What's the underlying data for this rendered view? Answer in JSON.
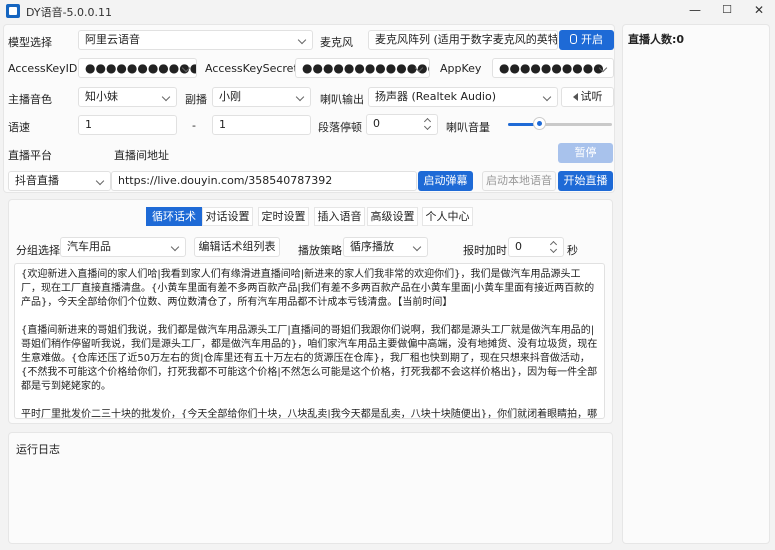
{
  "window": {
    "title": "DY语音-5.0.0.11",
    "minimize": "—",
    "maximize": "☐",
    "close": "✕"
  },
  "row1": {
    "model_label": "模型选择",
    "model_value": "阿里云语音",
    "mic_label": "麦克风",
    "mic_value": "麦克风阵列 (适用于数字麦克风的英特",
    "start_label": "开启"
  },
  "row2": {
    "akid_label": "AccessKeyID",
    "akid_value": "●●●●●●●●●●●●●",
    "aks_label": "AccessKeySecret",
    "aks_value": "●●●●●●●●●●●●●●●",
    "appkey_label": "AppKey",
    "appkey_value": "●●●●●●●●●●"
  },
  "row3": {
    "voice_label": "主播音色",
    "voice_value": "知小妹",
    "sub_label": "副播",
    "sub_value": "小刚",
    "out_label": "喇叭输出",
    "out_value": "扬声器 (Realtek Audio)",
    "test_label": "试听"
  },
  "row4": {
    "speed_label": "语速",
    "speed_a": "1",
    "speed_sep": "-",
    "speed_b": "1",
    "pause_label": "段落停顿",
    "pause_value": "0",
    "volume_label": "喇叭音量",
    "volume_level": 0.3
  },
  "row5": {
    "platform_label": "直播平台",
    "url_label": "直播间地址",
    "pause_btn": "暂停"
  },
  "row6": {
    "platform_value": "抖音直播",
    "url_value": "https://live.douyin.com/358540787392",
    "start_danmu": "启动弹幕",
    "start_local": "启动本地语音",
    "start_live": "开始直播"
  },
  "tabs": [
    "循环话术",
    "对话设置",
    "定时设置",
    "插入语音",
    "高级设置",
    "个人中心"
  ],
  "script_row": {
    "group_label": "分组选择",
    "group_value": "汽车用品",
    "edit_btn": "编辑话术组列表",
    "strategy_label": "播放策略",
    "strategy_value": "循序播放",
    "time_label": "报时加时",
    "time_value": "0",
    "time_unit": "秒"
  },
  "script_text": [
    "{欢迎新进入直播间的家人们哈|我看到家人们有缘滑进直播间哈|新进来的家人们我非常的欢迎你们}，我们是做汽车用品源头工厂，现在工厂直接直播清盘。{小黄车里面有差不多两百款产品|我们有差不多两百款产品在小黄车里面|小黄车里面有接近两百款的产品}，今天全部给你们个位数、两位数清仓了，所有汽车用品都不计成本亏钱清盘。【当前时间】",
    "{直播间新进来的哥姐们我说，我们都是做汽车用品源头工厂|直播间的哥姐们我跟你们说啊，我们都是源头工厂就是做汽车用品的|哥姐们稍作停留听我说，我们是源头工厂，都是做汽车用品的}，咱们家汽车用品主要做偏中高端，没有地摊货、没有垃圾货，现在生意难做。{仓库还压了近50万左右的货|仓库里还有五十万左右的货源压在仓库}，我厂租也快到期了，现在只想来抖音做活动，{不然我不可能这个价格给你们，打死我都不可能这个价格|不然怎么可能是这个价格，打死我都不会这样价格出}，因为每一件全部都是亏到姥姥家的。",
    "平时厂里批发价二三十块的批发价，{今天全部给你们十块，八块乱卖|我今天都是乱卖，八块十块随便出}，你们就闭着眼睛拍，哪个买回去都值个几十块，好不好?"
  ],
  "log": {
    "title": "运行日志"
  },
  "viewers": {
    "label": "直播人数:0"
  },
  "colors": {
    "accent": "#1e6ad6",
    "accent_disabled": "#a8c2ec"
  }
}
